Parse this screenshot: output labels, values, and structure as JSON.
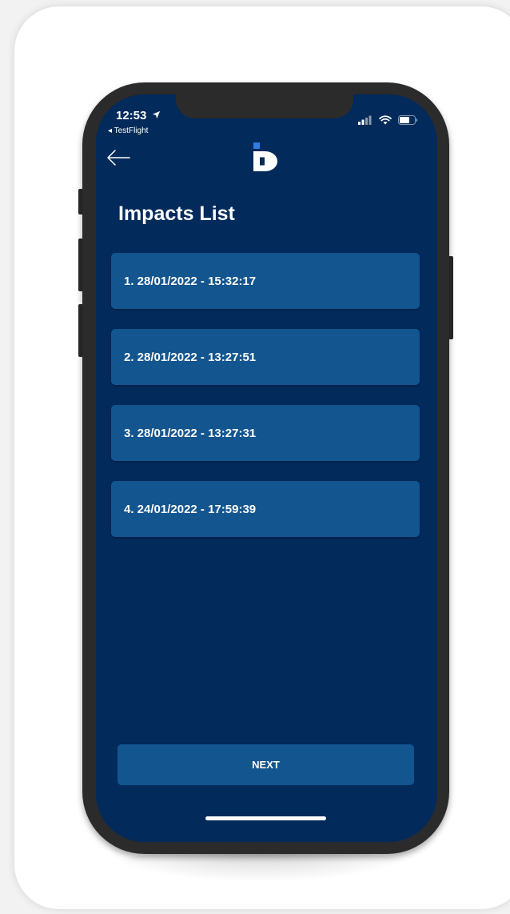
{
  "status_bar": {
    "time": "12:53",
    "back_app": "◂ TestFlight",
    "location_icon": "location-arrow-icon",
    "signal_icon": "cellular-signal-icon",
    "wifi_icon": "wifi-icon",
    "battery_icon": "battery-icon"
  },
  "header": {
    "back_icon": "arrow-left-icon",
    "logo_icon": "app-logo-icon"
  },
  "page": {
    "title": "Impacts List"
  },
  "impacts": [
    "1. 28/01/2022 - 15:32:17",
    "2. 28/01/2022 - 13:27:51",
    "3. 28/01/2022 - 13:27:31",
    "4. 24/01/2022 - 17:59:39"
  ],
  "footer": {
    "next_label": "NEXT"
  },
  "colors": {
    "screen_background": "#022a5b",
    "item_background": "#13558f",
    "logo_accent": "#2a7de1"
  }
}
